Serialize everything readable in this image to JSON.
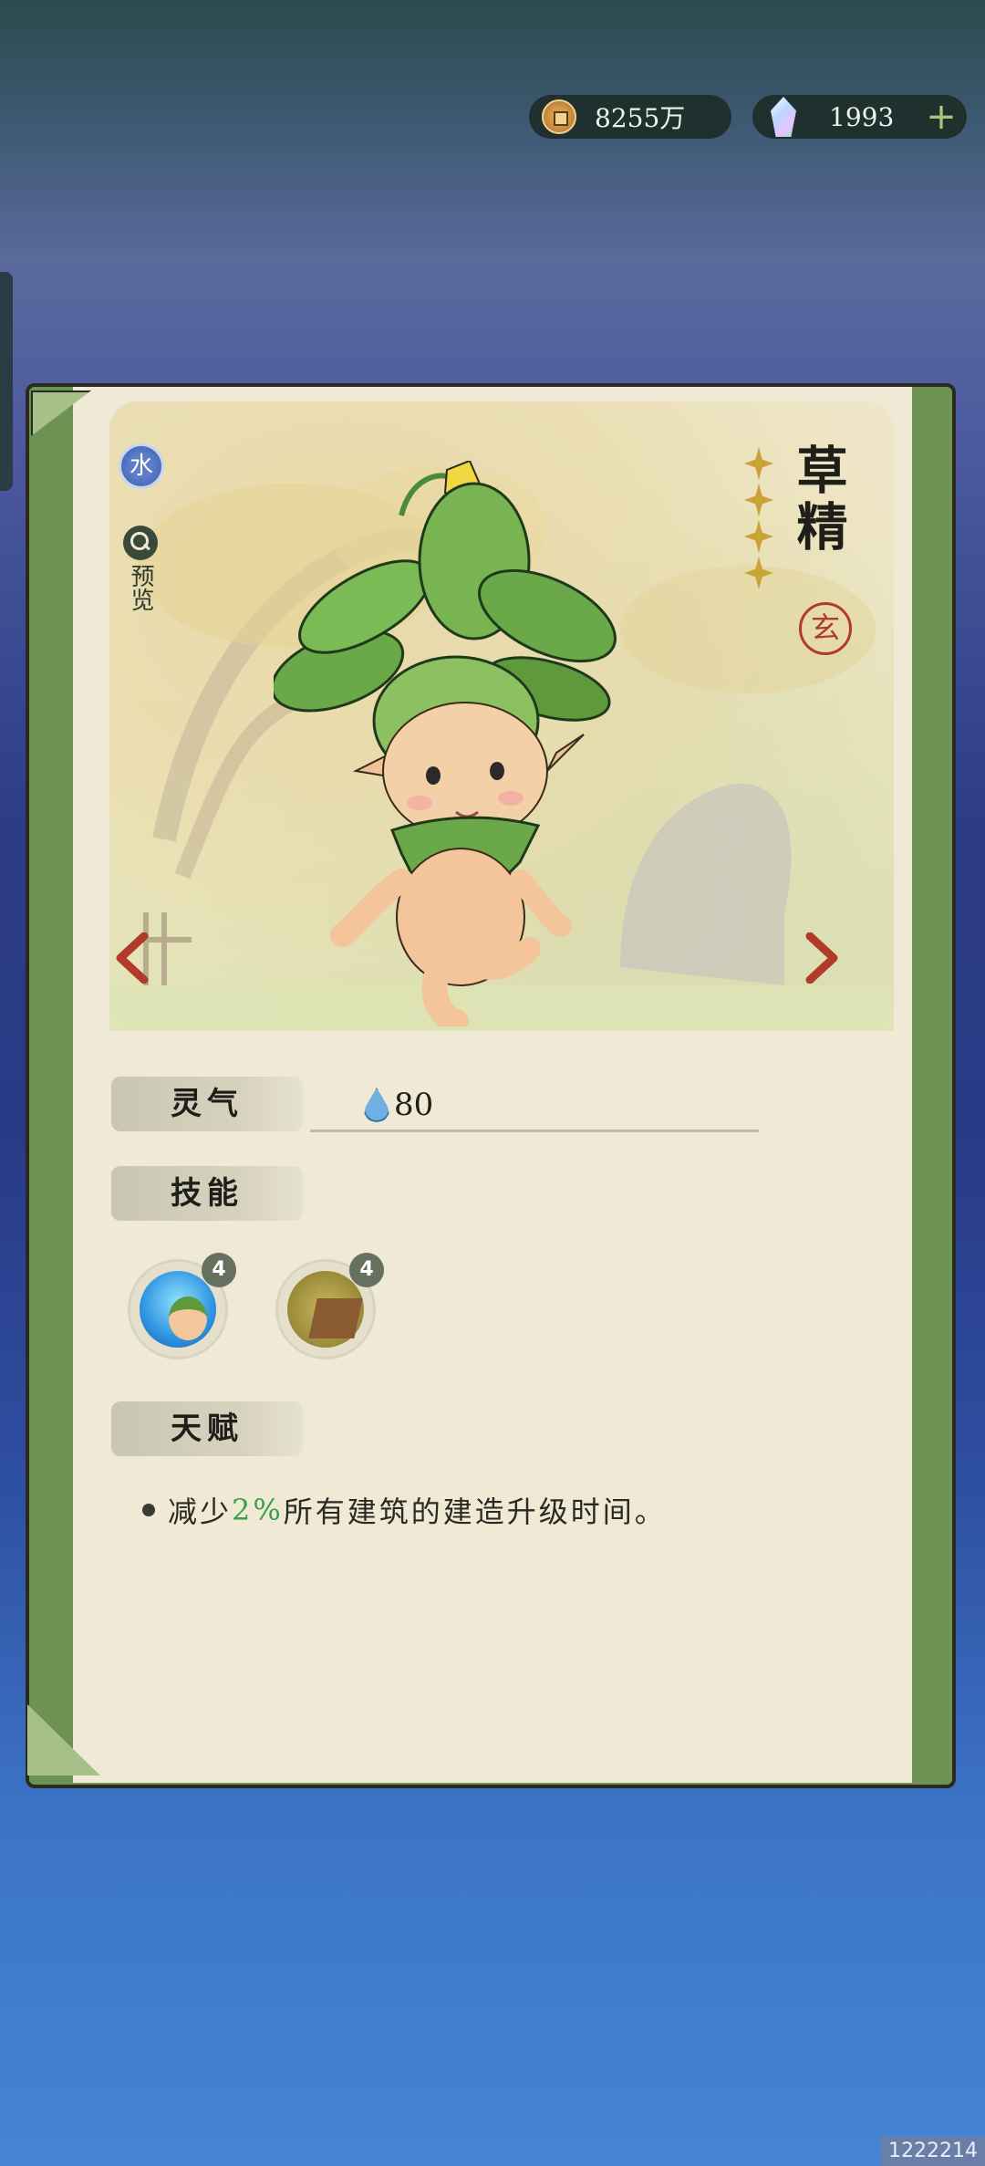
{
  "currency": {
    "coins": "8255万",
    "gems": "1993",
    "add_symbol": "+",
    "coin_icon": "copper-coin-icon",
    "gem_icon": "crystal-gem-icon"
  },
  "character": {
    "name": "草精",
    "element": "水",
    "rank_seal": "玄",
    "star_count": 4,
    "preview_label": "预览"
  },
  "stats": {
    "lingqi_label": "灵气",
    "lingqi_value": "80",
    "skills_label": "技能",
    "talent_label": "天赋"
  },
  "skills": [
    {
      "icon": "sprite-skill-icon",
      "level": "4"
    },
    {
      "icon": "seed-soil-skill-icon",
      "level": "4"
    }
  ],
  "talent": {
    "pre": "减少",
    "highlight": "2%",
    "post": "所有建筑的建造升级时间。"
  },
  "corner_id": "1222214",
  "colors": {
    "accent_green": "#3aa04a",
    "arrow_red": "#b23a2a",
    "element_blue": "#4a6cb8",
    "star_gold": "#c8a534"
  }
}
